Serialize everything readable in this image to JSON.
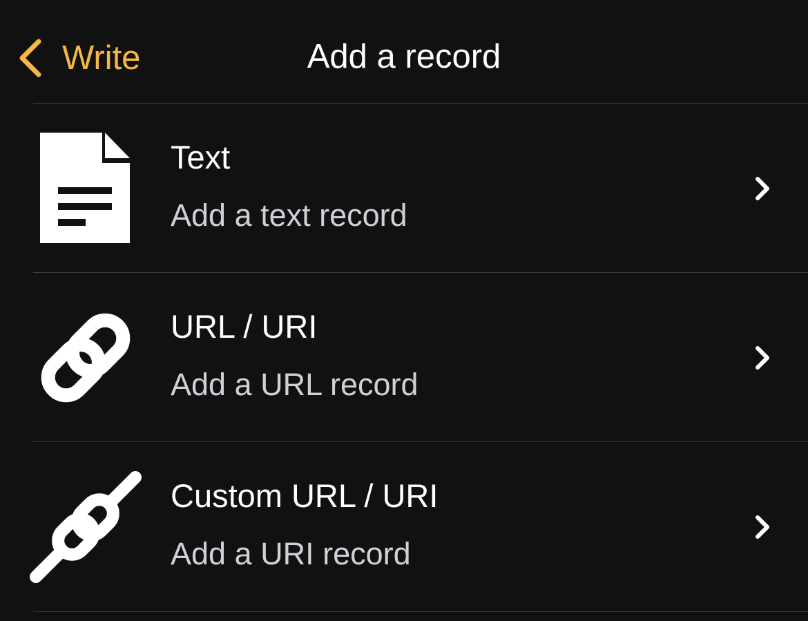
{
  "navbar": {
    "back_label": "Write",
    "back_icon": "chevron-left-icon",
    "title": "Add a record",
    "accent_color": "#F5B748"
  },
  "records": [
    {
      "icon": "document-icon",
      "title": "Text",
      "subtitle": "Add a text record",
      "disclosure_icon": "chevron-right-icon"
    },
    {
      "icon": "link-icon",
      "title": "URL / URI",
      "subtitle": "Add a URL record",
      "disclosure_icon": "chevron-right-icon"
    },
    {
      "icon": "custom-link-icon",
      "title": "Custom URL / URI",
      "subtitle": "Add a URI record",
      "disclosure_icon": "chevron-right-icon"
    }
  ]
}
